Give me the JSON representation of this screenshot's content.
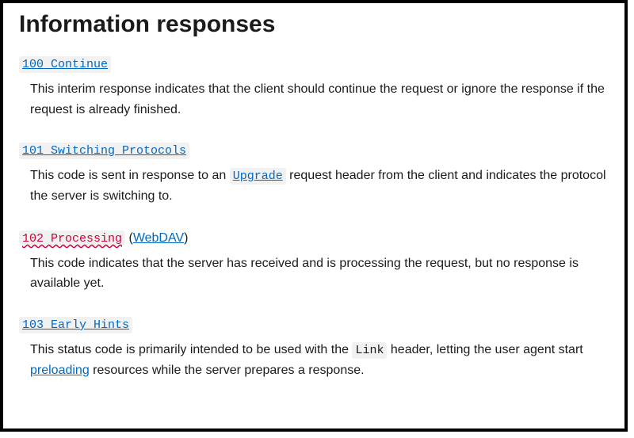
{
  "heading": "Information responses",
  "items": [
    {
      "code": "100 Continue",
      "extra_label": "",
      "code_class": "code-link",
      "desc_pre": "This interim response indicates that the client should continue the request or ignore the response if the request is already finished.",
      "inline_code": "",
      "desc_mid": "",
      "inline_link": "",
      "desc_post": ""
    },
    {
      "code": "101 Switching Protocols",
      "extra_label": "",
      "code_class": "code-link",
      "desc_pre": "This code is sent in response to an ",
      "inline_code": "Upgrade",
      "desc_mid": " request header from the client and indicates the protocol the server is switching to.",
      "inline_link": "",
      "desc_post": ""
    },
    {
      "code": "102 Processing",
      "extra_label": "WebDAV",
      "code_class": "code-deprecated",
      "desc_pre": "This code indicates that the server has received and is processing the request, but no response is available yet.",
      "inline_code": "",
      "desc_mid": "",
      "inline_link": "",
      "desc_post": ""
    },
    {
      "code": "103 Early Hints",
      "extra_label": "",
      "code_class": "code-link",
      "desc_pre": "This status code is primarily intended to be used with the ",
      "inline_code": "Link",
      "desc_mid": " header, letting the user agent start ",
      "inline_link": "preloading",
      "desc_post": " resources while the server prepares a response."
    }
  ]
}
